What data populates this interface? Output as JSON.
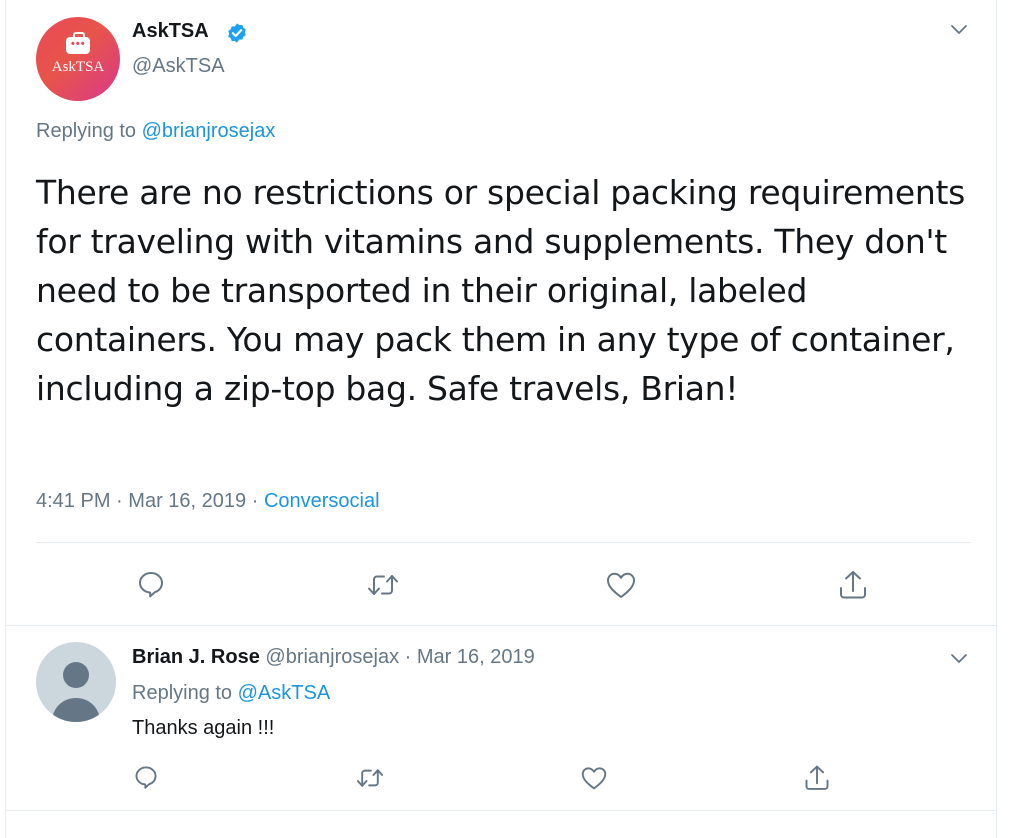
{
  "main_tweet": {
    "avatar_text": "AskTSA",
    "avatar_dots": "•••",
    "display_name": "AskTSA",
    "handle": "@AskTSA",
    "replying_prefix": "Replying to",
    "replying_handle": "@brianjrosejax",
    "text": "There are no restrictions or special packing requirements for traveling with vitamins and supplements. They don't need to be transported in their original, labeled containers. You may pack them in any type of container, including a zip-top bag. Safe travels, Brian!",
    "time": "4:41 PM",
    "separator": "·",
    "date": "Mar 16, 2019",
    "source": "Conversocial"
  },
  "reply_tweet": {
    "display_name": "Brian J. Rose",
    "handle": "@brianjrosejax",
    "separator": "·",
    "date": "Mar 16, 2019",
    "replying_prefix": "Replying to",
    "replying_handle": "@AskTSA",
    "text": "Thanks again !!!"
  },
  "icons": [
    "chevron-down-icon",
    "verified-badge-icon",
    "reply-icon",
    "retweet-icon",
    "like-icon",
    "share-icon",
    "default-avatar-icon"
  ],
  "colors": {
    "link": "#1b95e0",
    "secondary_text": "#657786",
    "primary_text": "#14171a",
    "divider": "#e6ecf0",
    "verified": "#1da1f2"
  }
}
